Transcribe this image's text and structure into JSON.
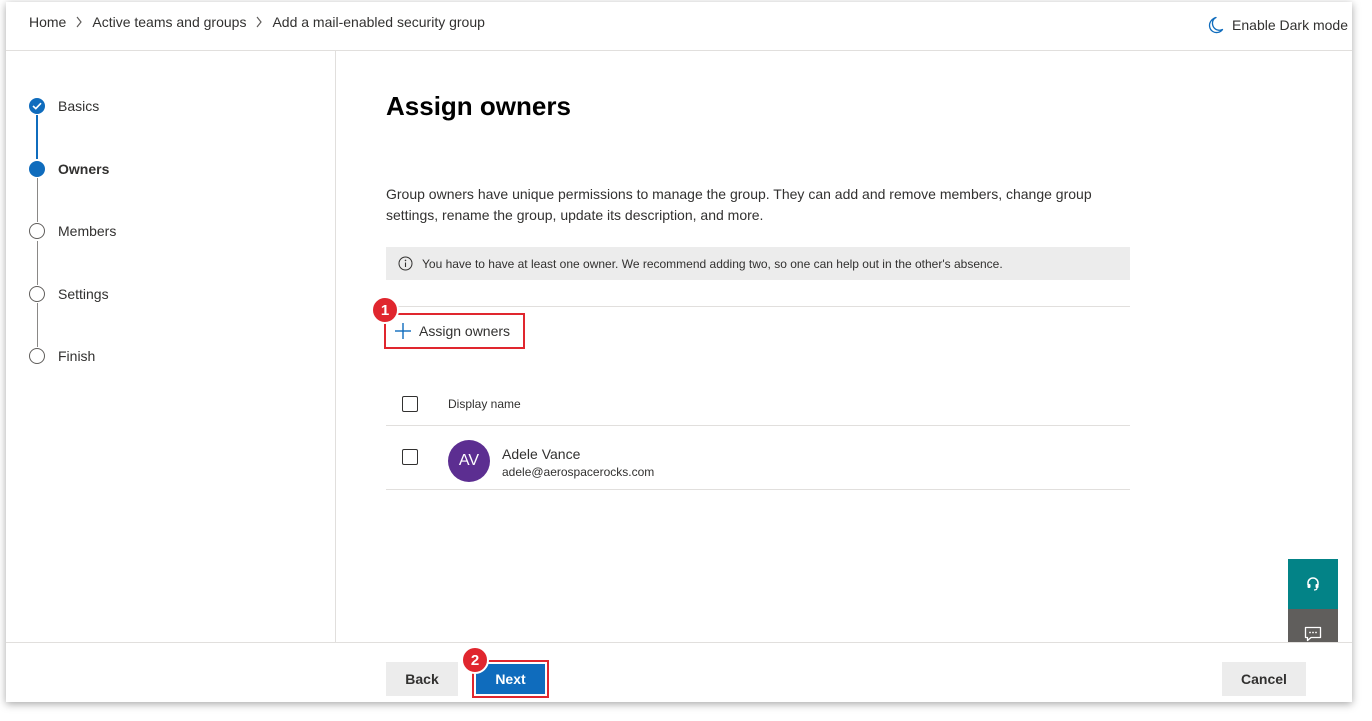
{
  "breadcrumb": {
    "items": [
      "Home",
      "Active teams and groups",
      "Add a mail-enabled security group"
    ]
  },
  "header": {
    "dark_mode_label": "Enable Dark mode"
  },
  "wizard": {
    "steps": [
      {
        "label": "Basics",
        "state": "done"
      },
      {
        "label": "Owners",
        "state": "current"
      },
      {
        "label": "Members",
        "state": "todo"
      },
      {
        "label": "Settings",
        "state": "todo"
      },
      {
        "label": "Finish",
        "state": "todo"
      }
    ]
  },
  "main": {
    "title": "Assign owners",
    "description": "Group owners have unique permissions to manage the group. They can add and remove members, change group settings, rename the group, update its description, and more.",
    "info": "You have to have at least one owner. We recommend adding two, so one can help out in the other's absence.",
    "assign_button_label": "Assign owners",
    "table": {
      "column_header": "Display name",
      "rows": [
        {
          "initials": "AV",
          "name": "Adele Vance",
          "email": "adele@aerospacerocks.com",
          "avatar_color": "#5c2e91"
        }
      ]
    }
  },
  "annotations": {
    "badge_1": "1",
    "badge_2": "2"
  },
  "footer": {
    "back_label": "Back",
    "next_label": "Next",
    "cancel_label": "Cancel"
  },
  "colors": {
    "accent": "#0f6cbd",
    "annotation": "#e0262e",
    "help_fab": "#038387",
    "feedback_fab": "#605e5c"
  },
  "icons": {
    "dark_mode": "moon-icon",
    "info": "info-icon",
    "add": "plus-icon",
    "help": "headset-icon",
    "feedback": "feedback-icon"
  }
}
